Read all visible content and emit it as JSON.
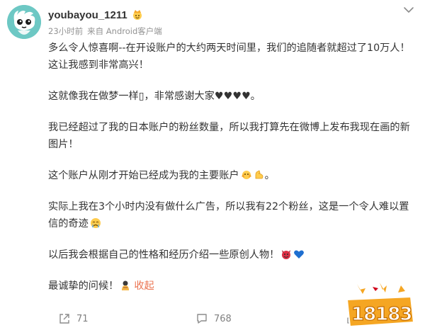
{
  "post": {
    "username": "youbayou_1211",
    "time": "23小时前",
    "source": "来自 Android客户端",
    "paragraphs": [
      "多么令人惊喜啊--在开设账户的大约两天时间里，我们的追随者就超过了10万人！这让我感到非常高兴！",
      "这就像我在做梦一样▯，非常感谢大家♥♥♥♥。",
      "我已经超过了我的日本账户的粉丝数量，所以我打算先在微博上发布我现在画的新图片！",
      "这个账户从刚才开始已经成为我的主要账户",
      "实际上我在3个小时内没有做什么广告，所以我有22个粉丝，这是一个令人难以置信的奇迹",
      "以后我会根据自己的性格和经历介绍一些原创人物！",
      "最诚挚的问候！"
    ],
    "collapse_label": "收起"
  },
  "actions": {
    "repost_count": "71",
    "comment_count": "768"
  },
  "watermark_text": "18183",
  "colors": {
    "link": "#eb7350",
    "meta": "#939393",
    "avatar_bg": "#6dc8c4"
  },
  "icons": [
    "avatar-character",
    "crown-emoji-icon",
    "chevron-down-icon",
    "hands-emoji-icon",
    "muscle-emoji-icon",
    "crying-emoji-icon",
    "devil-emoji-icon",
    "blue-heart-icon",
    "bowing-emoji-icon",
    "repost-icon",
    "comment-icon",
    "like-icon"
  ]
}
